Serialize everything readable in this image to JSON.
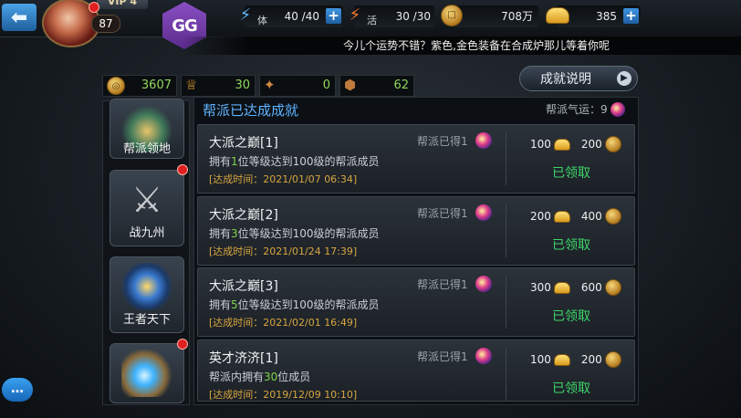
{
  "header": {
    "back_icon": "back-arrow-icon",
    "vip_label": "VIP 4",
    "level": "87",
    "gg_label": "GG",
    "stamina": {
      "label": "体",
      "value": "40 /40"
    },
    "vitality": {
      "label": "活",
      "value": "30 /30"
    },
    "copper": {
      "value": "708万"
    },
    "gold": {
      "value": "385"
    }
  },
  "marquee": "今儿个运势不错？紫色,金色装备在合成炉那儿等着你呢",
  "resources": [
    "3607",
    "30",
    "0",
    "62"
  ],
  "achievement_button": "成就说明",
  "nav": [
    {
      "label": "帮派领地",
      "badge": false
    },
    {
      "label": "战九州",
      "badge": true
    },
    {
      "label": "王者天下",
      "badge": false
    },
    {
      "label": "",
      "badge": true
    }
  ],
  "section": {
    "title": "帮派已达成成就",
    "fortune_label": "帮派气运：9"
  },
  "achievements": [
    {
      "title": "大派之巅[1]",
      "desc_pre": "拥有",
      "desc_num": "1",
      "desc_post": "位等级达到100级的帮派成员",
      "date": "[达成时间：2021/01/07  06:34]",
      "got": "帮派已得1",
      "reward1": "100",
      "reward2": "200",
      "status": "已领取"
    },
    {
      "title": "大派之巅[2]",
      "desc_pre": "拥有",
      "desc_num": "3",
      "desc_post": "位等级达到100级的帮派成员",
      "date": "[达成时间：2021/01/24  17:39]",
      "got": "帮派已得1",
      "reward1": "200",
      "reward2": "400",
      "status": "已领取"
    },
    {
      "title": "大派之巅[3]",
      "desc_pre": "拥有",
      "desc_num": "5",
      "desc_post": "位等级达到100级的帮派成员",
      "date": "[达成时间：2021/02/01  16:49]",
      "got": "帮派已得1",
      "reward1": "300",
      "reward2": "600",
      "status": "已领取"
    },
    {
      "title": "英才济济[1]",
      "desc_pre": "帮派内拥有",
      "desc_num": "30",
      "desc_post": "位成员",
      "date": "[达成时间：2019/12/09  10:10]",
      "got": "帮派已得1",
      "reward1": "100",
      "reward2": "200",
      "status": "已领取"
    }
  ],
  "colors": {
    "accent_blue": "#5fb3ff",
    "claimed_green": "#3dd66a",
    "date_gold": "#d8a640",
    "highlight_green": "#7fd24a"
  }
}
